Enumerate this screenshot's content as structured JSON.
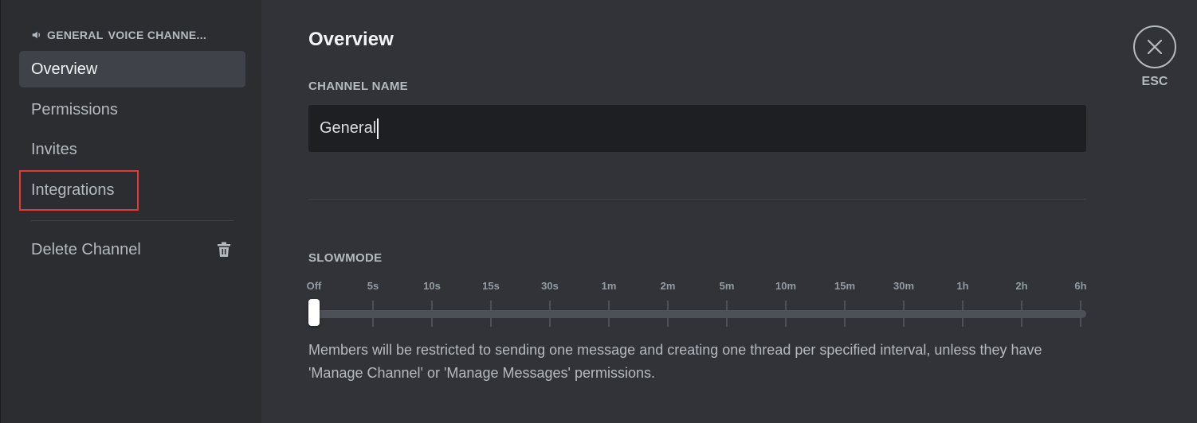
{
  "sidebar": {
    "header_prefix": "GENERAL",
    "header_rest": "VOICE CHANNE...",
    "items": [
      {
        "label": "Overview"
      },
      {
        "label": "Permissions"
      },
      {
        "label": "Invites"
      },
      {
        "label": "Integrations"
      }
    ],
    "delete_label": "Delete Channel"
  },
  "main": {
    "title": "Overview",
    "channel_name_label": "CHANNEL NAME",
    "channel_name_value": "General",
    "slowmode_label": "SLOWMODE",
    "slowmode_ticks": [
      "Off",
      "5s",
      "10s",
      "15s",
      "30s",
      "1m",
      "2m",
      "5m",
      "10m",
      "15m",
      "30m",
      "1h",
      "2h",
      "6h"
    ],
    "slowmode_selected": "Off",
    "help_text": "Members will be restricted to sending one message and creating one thread per specified interval, unless they have 'Manage Channel' or 'Manage Messages' permissions."
  },
  "close": {
    "label": "ESC"
  },
  "colors": {
    "accent_outline": "#e53935",
    "background": "#313338",
    "sidebar": "#2b2d31"
  }
}
